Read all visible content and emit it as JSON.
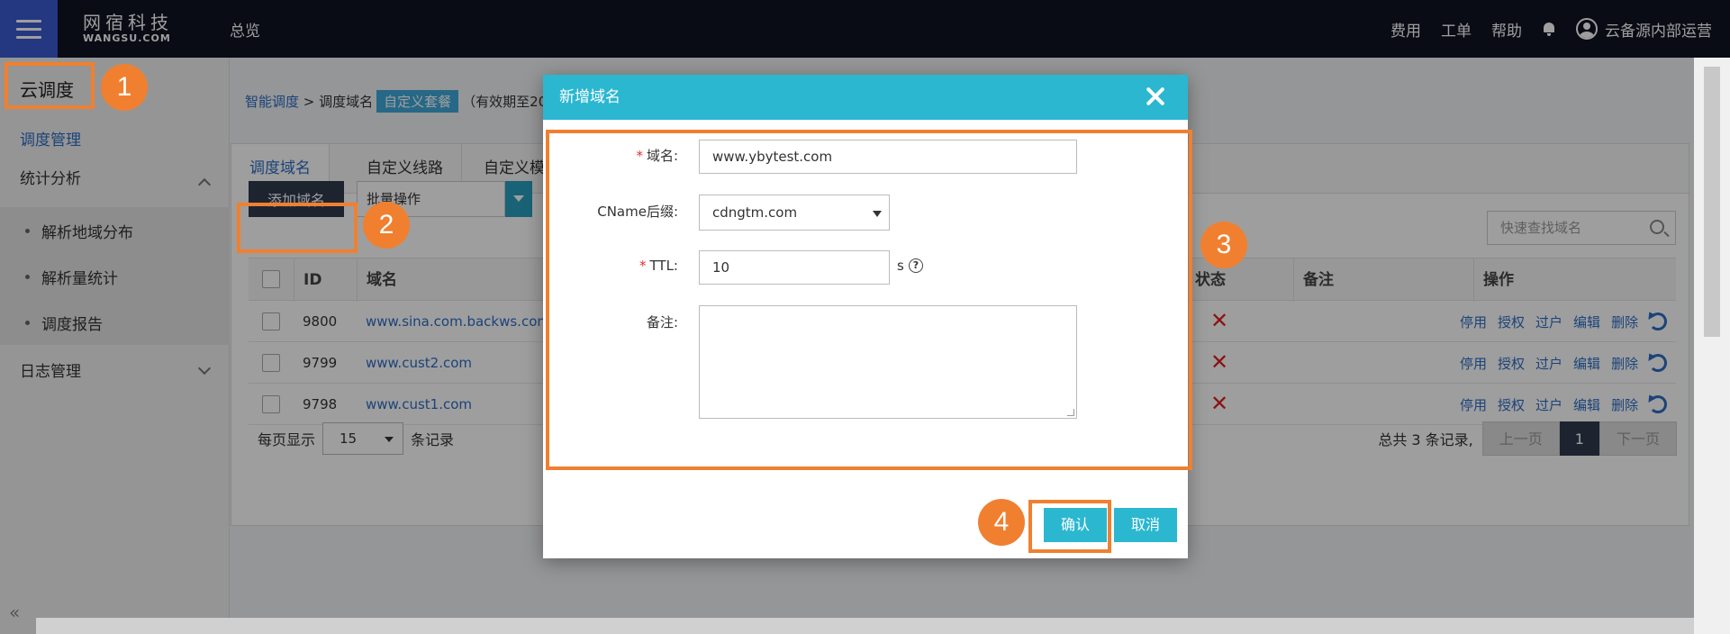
{
  "topbar": {
    "logo_cn": "网宿科技",
    "logo_en": "WANGSU.COM",
    "overview": "总览",
    "fees": "费用",
    "ticket": "工单",
    "help": "帮助",
    "user": "云备源内部运营"
  },
  "sidebar": {
    "title": "云调度",
    "items": [
      {
        "label": "调度管理"
      },
      {
        "label": "统计分析"
      },
      {
        "label": "解析地域分布"
      },
      {
        "label": "解析量统计"
      },
      {
        "label": "调度报告"
      },
      {
        "label": "日志管理"
      }
    ],
    "collapse": "«"
  },
  "breadcrumb": {
    "root": "智能调度",
    "sep": " > ",
    "current": "调度域名",
    "tag": "自定义套餐",
    "validity": "（有效期至20"
  },
  "tabs": [
    "调度域名",
    "自定义线路",
    "自定义模"
  ],
  "toolbar": {
    "add_label": "添加域名",
    "batch_label": "批量操作",
    "search_placeholder": "快速查找域名"
  },
  "table": {
    "headers": [
      "ID",
      "域名",
      "状态",
      "备注",
      "操作"
    ],
    "rows": [
      {
        "id": "9800",
        "domain": "www.sina.com.backws.com"
      },
      {
        "id": "9799",
        "domain": "www.cust2.com"
      },
      {
        "id": "9798",
        "domain": "www.cust1.com"
      }
    ],
    "ops": [
      "停用",
      "授权",
      "过户",
      "编辑",
      "删除"
    ]
  },
  "footer": {
    "per_page_prefix": "每页显示",
    "per_page_value": "15",
    "per_page_suffix": "条记录",
    "total": "总共 3 条记录,",
    "prev": "上一页",
    "page": "1",
    "next": "下一页"
  },
  "modal": {
    "title": "新增域名",
    "req_mark": "*",
    "domain_label": "域名:",
    "domain_value": "www.ybytest.com",
    "cname_label": "CName后缀:",
    "cname_value": "cdngtm.com",
    "ttl_label": "TTL:",
    "ttl_value": "10",
    "ttl_unit": "s",
    "help_glyph": "?",
    "note_label": "备注:",
    "ok": "确认",
    "cancel": "取消"
  },
  "annotations": [
    "1",
    "2",
    "3",
    "4"
  ],
  "colors": {
    "accent": "#2bb7d0",
    "highlight": "#f08030",
    "topbar": "#0f1323",
    "link": "#2d6cc4"
  }
}
